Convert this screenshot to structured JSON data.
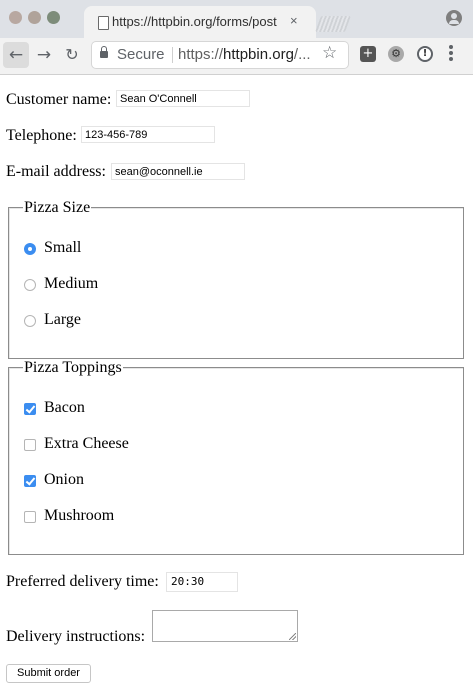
{
  "browser": {
    "tab_title": "https://httpbin.org/forms/post",
    "tab_close": "×",
    "secure_label": "Secure",
    "url_prefix": "https://",
    "url_host": "httpbin.org",
    "url_suffix": "/...",
    "icons": [
      "back-arrow-icon",
      "forward-arrow-icon",
      "reload-icon",
      "lock-icon",
      "star-icon",
      "extension-icon",
      "menu-dots-icon",
      "profile-icon"
    ]
  },
  "form": {
    "customer_name_label": "Customer name:",
    "customer_name_value": "Sean O'Connell",
    "telephone_label": "Telephone:",
    "telephone_value": "123-456-789",
    "email_label": "E-mail address:",
    "email_value": "sean@oconnell.ie",
    "pizza_size": {
      "legend": "Pizza Size",
      "options": [
        {
          "label": "Small",
          "selected": true
        },
        {
          "label": "Medium",
          "selected": false
        },
        {
          "label": "Large",
          "selected": false
        }
      ]
    },
    "toppings": {
      "legend": "Pizza Toppings",
      "options": [
        {
          "label": "Bacon",
          "checked": true
        },
        {
          "label": "Extra Cheese",
          "checked": false
        },
        {
          "label": "Onion",
          "checked": true
        },
        {
          "label": "Mushroom",
          "checked": false
        }
      ]
    },
    "delivery_time_label": "Preferred delivery time:",
    "delivery_time_value": "20:30",
    "instructions_label": "Delivery instructions:",
    "instructions_value": "",
    "submit_label": "Submit order"
  },
  "colors": {
    "accent": "#3b8df0",
    "chrome_bg": "#dee1e6",
    "toolbar_bg": "#f2f2f2"
  }
}
